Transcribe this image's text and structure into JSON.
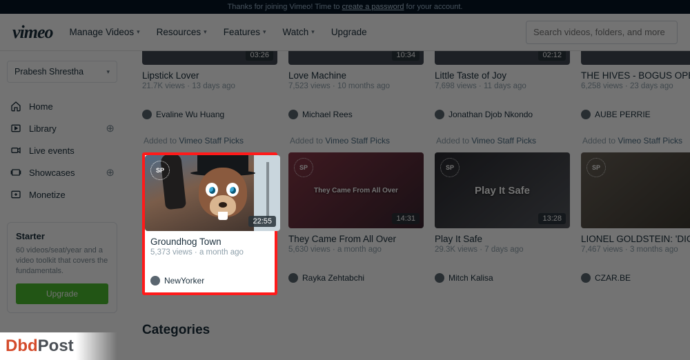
{
  "banner": {
    "pre": "Thanks for joining Vimeo! Time to ",
    "link": "create a password",
    "post": " for your account."
  },
  "nav": {
    "manage": "Manage Videos",
    "resources": "Resources",
    "features": "Features",
    "watch": "Watch",
    "upgrade": "Upgrade"
  },
  "search": {
    "placeholder": "Search videos, folders, and more"
  },
  "user": {
    "name": "Prabesh Shrestha"
  },
  "sidebar": {
    "home": "Home",
    "library": "Library",
    "live": "Live events",
    "showcases": "Showcases",
    "monetize": "Monetize"
  },
  "starter": {
    "title": "Starter",
    "desc": "60 videos/seat/year and a video toolkit that covers the fundamentals.",
    "cta": "Upgrade"
  },
  "addedTo": {
    "pre": "Added to ",
    "link": "Vimeo Staff Picks"
  },
  "sp": "SP",
  "row1": [
    {
      "dur": "03:26",
      "title": "Lipstick Lover",
      "meta": "21.7K views · 13 days ago",
      "author": "Evaline Wu Huang"
    },
    {
      "dur": "10:34",
      "title": "Love Machine",
      "meta": "7,523 views · 10 months ago",
      "author": "Michael Rees"
    },
    {
      "dur": "02:12",
      "title": "Little Taste of Joy",
      "meta": "7,698 views · 11 days ago",
      "author": "Jonathan Djob Nkondo"
    },
    {
      "dur": "",
      "title": "THE HIVES - BOGUS OPER",
      "meta": "6,258 views · 23 days ago",
      "author": "AUBE PERRIE"
    }
  ],
  "row2": [
    {
      "dur": "22:55",
      "title": "Groundhog Town",
      "meta": "5,373 views · a month ago",
      "author": "NewYorker"
    },
    {
      "dur": "14:31",
      "title": "They Came From All Over",
      "meta": "5,630 views · a month ago",
      "author": "Rayka Zehtabchi",
      "overlay": "They Came From All Over"
    },
    {
      "dur": "13:28",
      "title": "Play It Safe",
      "meta": "29.3K views · 7 days ago",
      "author": "Mitch Kalisa",
      "overlay": "Play It Safe"
    },
    {
      "dur": "",
      "title": "LIONEL GOLDSTEIN: 'DICH",
      "meta": "7,467 views · 3 months ago",
      "author": "CZAR.BE"
    }
  ],
  "categories": "Categories",
  "brand": {
    "a": "Dbd",
    "b": "Post"
  }
}
